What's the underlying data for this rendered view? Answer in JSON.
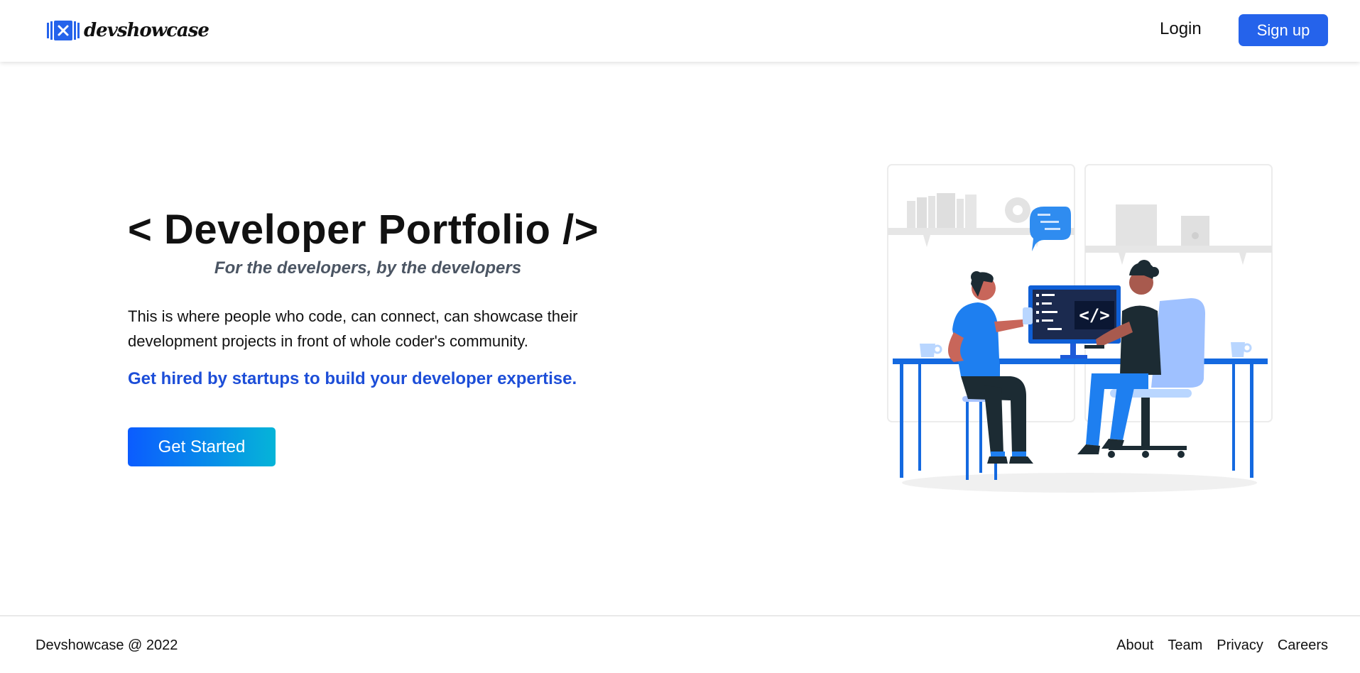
{
  "header": {
    "logo_text": "devshowcase",
    "login_label": "Login",
    "signup_label": "Sign up"
  },
  "hero": {
    "title": "< Developer Portfolio />",
    "tagline": "For the developers, by the developers",
    "description": "This is where people who code, can connect, can showcase their development projects in front of whole coder's community.",
    "highlight": "Get hired by startups to build your developer expertise.",
    "cta_label": "Get Started",
    "illustration_icon": "developers-at-desk-illustration",
    "screen_code_text": "</>"
  },
  "footer": {
    "copyright": "Devshowcase @ 2022",
    "links": [
      "About",
      "Team",
      "Privacy",
      "Careers"
    ]
  },
  "colors": {
    "brand": "#2563eb",
    "highlight": "#1d4ed8",
    "cta_start": "#0b5cff",
    "cta_end": "#05b4d8",
    "tagline": "#4b5563"
  }
}
